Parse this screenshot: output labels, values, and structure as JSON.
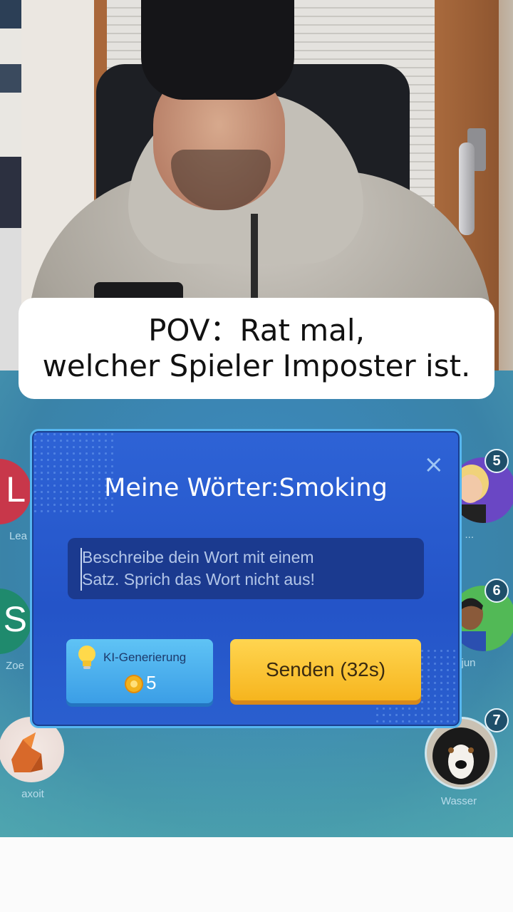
{
  "caption": {
    "line1": "POV：Rat mal,",
    "line2": "welcher Spieler Imposter ist."
  },
  "dialog": {
    "title": "Meine Wörter:Smoking",
    "close_icon": "×",
    "placeholder_line1": "Beschreibe dein Wort mit einem",
    "placeholder_line2": "Satz. Sprich das Wort nicht aus!",
    "ai_button_label": "KI-Generierung",
    "ai_button_cost": "5",
    "send_button_label": "Senden (32s)"
  },
  "players": {
    "left_top": {
      "initial": "L",
      "name": "Lea",
      "color": "#c8374a"
    },
    "left_mid": {
      "initial": "S",
      "name": "Zoe",
      "color": "#1f8a6d"
    },
    "left_bottom": {
      "name": "axoit"
    },
    "right_top": {
      "number": "5",
      "name": "ri ..."
    },
    "right_mid": {
      "number": "6",
      "name": "sjun"
    },
    "right_bottom": {
      "number": "7",
      "name": "Wasser"
    }
  },
  "colors": {
    "dialog_bg": "#2a5acc",
    "send_button": "#f8bf2a",
    "ai_button": "#4fb2f0"
  }
}
